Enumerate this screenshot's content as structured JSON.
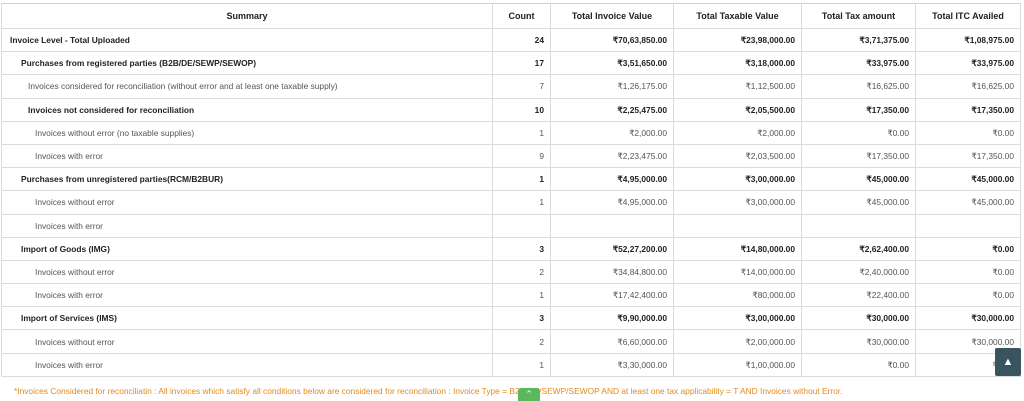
{
  "columns": [
    "Summary",
    "Count",
    "Total Invoice Value",
    "Total Taxable Value",
    "Total Tax amount",
    "Total ITC Availed"
  ],
  "rows": [
    {
      "label": "Invoice Level - Total Uploaded",
      "count": "24",
      "invoice": "₹70,63,850.00",
      "taxable": "₹23,98,000.00",
      "tax": "₹3,71,375.00",
      "itc": "₹1,08,975.00",
      "bold": true,
      "level": 0
    },
    {
      "label": "Purchases from registered parties (B2B/DE/SEWP/SEWOP)",
      "count": "17",
      "invoice": "₹3,51,650.00",
      "taxable": "₹3,18,000.00",
      "tax": "₹33,975.00",
      "itc": "₹33,975.00",
      "bold": true,
      "level": 1
    },
    {
      "label": "Invoices considered for reconciliation (without error and at least one taxable supply)",
      "count": "7",
      "invoice": "₹1,26,175.00",
      "taxable": "₹1,12,500.00",
      "tax": "₹16,625.00",
      "itc": "₹16,625.00",
      "bold": false,
      "level": 2
    },
    {
      "label": "Invoices not considered for reconciliation",
      "count": "10",
      "invoice": "₹2,25,475.00",
      "taxable": "₹2,05,500.00",
      "tax": "₹17,350.00",
      "itc": "₹17,350.00",
      "bold": true,
      "level": 2
    },
    {
      "label": "Invoices without error (no taxable supplies)",
      "count": "1",
      "invoice": "₹2,000.00",
      "taxable": "₹2,000.00",
      "tax": "₹0.00",
      "itc": "₹0.00",
      "bold": false,
      "level": 3
    },
    {
      "label": "Invoices with error",
      "count": "9",
      "invoice": "₹2,23,475.00",
      "taxable": "₹2,03,500.00",
      "tax": "₹17,350.00",
      "itc": "₹17,350.00",
      "bold": false,
      "level": 3
    },
    {
      "label": "Purchases from unregistered parties(RCM/B2BUR)",
      "count": "1",
      "invoice": "₹4,95,000.00",
      "taxable": "₹3,00,000.00",
      "tax": "₹45,000.00",
      "itc": "₹45,000.00",
      "bold": true,
      "level": 1
    },
    {
      "label": "Invoices without error",
      "count": "1",
      "invoice": "₹4,95,000.00",
      "taxable": "₹3,00,000.00",
      "tax": "₹45,000.00",
      "itc": "₹45,000.00",
      "bold": false,
      "level": 3
    },
    {
      "label": "Invoices with error",
      "count": "",
      "invoice": "",
      "taxable": "",
      "tax": "",
      "itc": "",
      "bold": false,
      "level": 3
    },
    {
      "label": "Import of Goods (IMG)",
      "count": "3",
      "invoice": "₹52,27,200.00",
      "taxable": "₹14,80,000.00",
      "tax": "₹2,62,400.00",
      "itc": "₹0.00",
      "bold": true,
      "level": 1
    },
    {
      "label": "Invoices without error",
      "count": "2",
      "invoice": "₹34,84,800.00",
      "taxable": "₹14,00,000.00",
      "tax": "₹2,40,000.00",
      "itc": "₹0.00",
      "bold": false,
      "level": 3
    },
    {
      "label": "Invoices with error",
      "count": "1",
      "invoice": "₹17,42,400.00",
      "taxable": "₹80,000.00",
      "tax": "₹22,400.00",
      "itc": "₹0.00",
      "bold": false,
      "level": 3
    },
    {
      "label": "Import of Services (IMS)",
      "count": "3",
      "invoice": "₹9,90,000.00",
      "taxable": "₹3,00,000.00",
      "tax": "₹30,000.00",
      "itc": "₹30,000.00",
      "bold": true,
      "level": 1
    },
    {
      "label": "Invoices without error",
      "count": "2",
      "invoice": "₹6,60,000.00",
      "taxable": "₹2,00,000.00",
      "tax": "₹30,000.00",
      "itc": "₹30,000.00",
      "bold": false,
      "level": 3
    },
    {
      "label": "Invoices with error",
      "count": "1",
      "invoice": "₹3,30,000.00",
      "taxable": "₹1,00,000.00",
      "tax": "₹0.00",
      "itc": "₹0.00",
      "bold": false,
      "level": 3
    }
  ],
  "footnote": "*Invoices Considered for reconciliatin : All invoices which satisfy all conditions below are considered for reconciliation : Invoice Type = B2B/DE/SEWP/SEWOP AND at least one tax applicability = T AND Invoices without Error.",
  "icons": {
    "scroll_top": "arrow-up-icon",
    "collapse": "chevron-up-icon"
  },
  "colors": {
    "footnote": "#e08a1e",
    "scroll_button": "#37545f",
    "collapse_button": "#5cb85c"
  }
}
